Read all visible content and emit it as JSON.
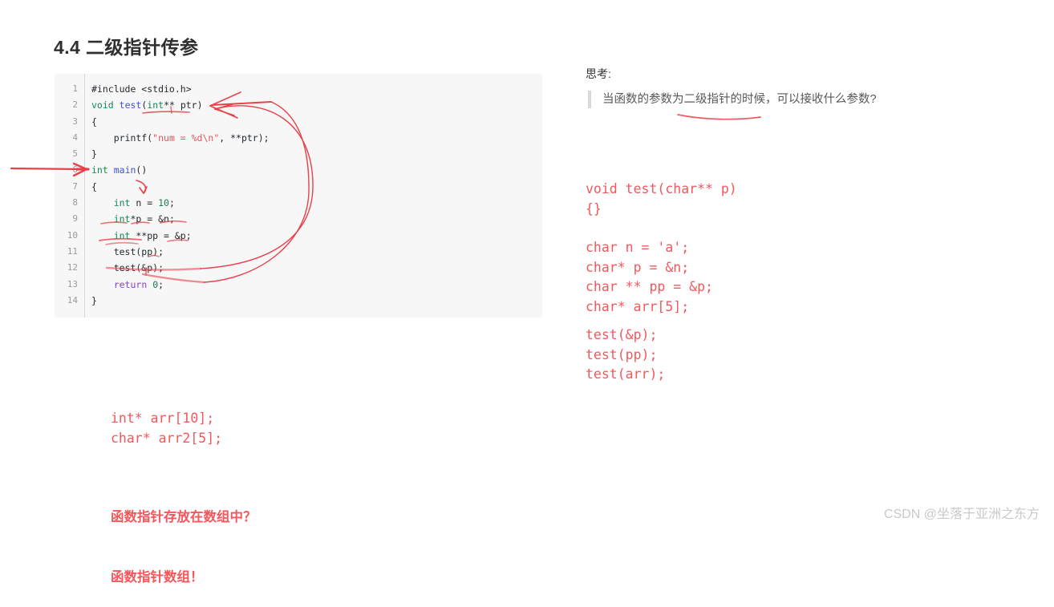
{
  "page": {
    "title": "4.4 二级指针传参",
    "background_color": "#ffffff"
  },
  "code_block": {
    "background_color": "#f7f7f8",
    "gutter_color": "#9b9b9b",
    "lines": [
      {
        "n": "1",
        "text": "#include <stdio.h>"
      },
      {
        "n": "2",
        "text": "void test(int** ptr)"
      },
      {
        "n": "3",
        "text": "{"
      },
      {
        "n": "4",
        "text": "    printf(\"num = %d\\n\", **ptr);"
      },
      {
        "n": "5",
        "text": "}"
      },
      {
        "n": "6",
        "text": "int main()"
      },
      {
        "n": "7",
        "text": "{"
      },
      {
        "n": "8",
        "text": "    int n = 10;"
      },
      {
        "n": "9",
        "text": "    int*p = &n;"
      },
      {
        "n": "10",
        "text": "    int **pp = &p;"
      },
      {
        "n": "11",
        "text": "    test(pp);"
      },
      {
        "n": "12",
        "text": "    test(&p);"
      },
      {
        "n": "13",
        "text": "    return 0;"
      },
      {
        "n": "14",
        "text": "}"
      }
    ]
  },
  "right_panel": {
    "think_label": "思考:",
    "question": "当函数的参数为二级指针的时候，可以接收什么参数?",
    "code_group_1": "void test(char** p)\n{}",
    "code_group_2": "char n = 'a';\nchar* p = &n;\nchar ** pp = &p;\nchar* arr[5];",
    "code_group_3": "test(&p);\ntest(pp);\ntest(arr);"
  },
  "left_notes": {
    "declarations": "int* arr[10];\nchar* arr2[5];",
    "question_line": "函数指针存放在数组中？",
    "answer_line": "函数指针数组！"
  },
  "annotation_color": "#e8414a",
  "watermark": "CSDN @坐落于亚洲之东方"
}
